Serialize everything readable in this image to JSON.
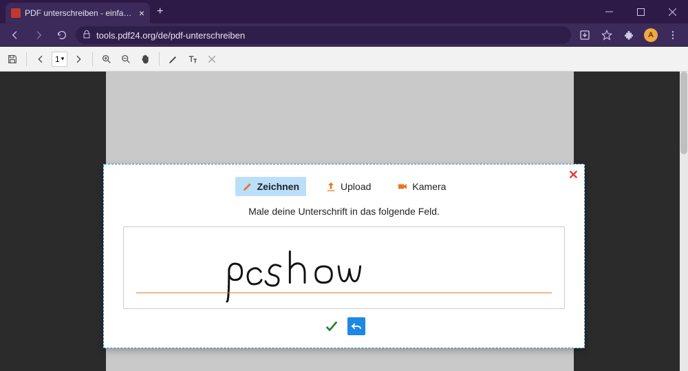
{
  "browser": {
    "tab_title": "PDF unterschreiben - einfach, online",
    "url": "tools.pdf24.org/de/pdf-unterschreiben",
    "avatar_letter": "A"
  },
  "toolbar": {
    "page_select": "1"
  },
  "modal": {
    "tabs": {
      "draw": "Zeichnen",
      "upload": "Upload",
      "camera": "Kamera"
    },
    "instruction": "Male deine Unterschrift in das folgende Feld.",
    "signature_text": "pcshow"
  }
}
